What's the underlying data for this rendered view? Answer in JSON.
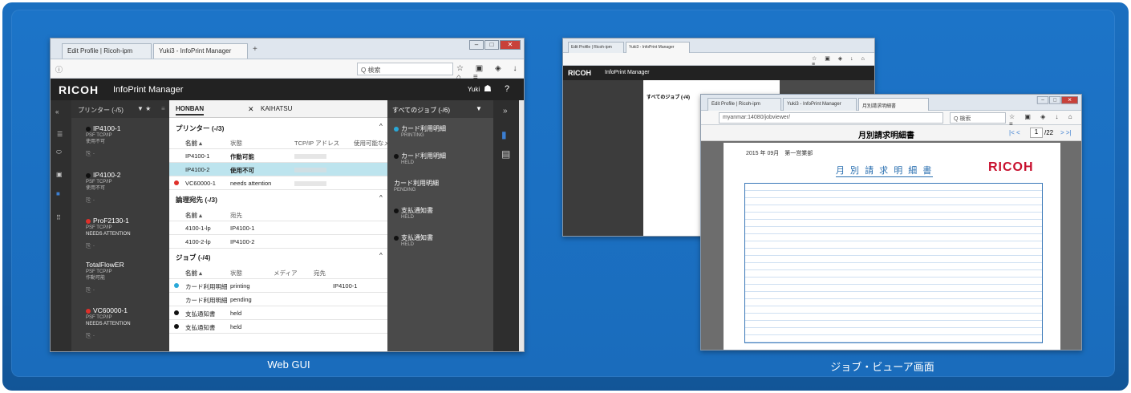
{
  "captions": {
    "left": "Web GUI",
    "right": "ジョブ・ビューア画面"
  },
  "left_window": {
    "tabs": [
      "Edit Profile | Ricoh-ipm",
      "Yuki3 - InfoPrint Manager"
    ],
    "search_placeholder": "Q 検索",
    "brand": "RICOH",
    "product": "InfoPrint Manager",
    "user": "Yuki",
    "help": "?",
    "sidebar_header": "プリンター (-/5)",
    "printers": [
      {
        "name": "IP4100-1",
        "sub1": "PSF TCP/IP",
        "sub2": "使用不可",
        "color": "#111"
      },
      {
        "name": "IP4100-2",
        "sub1": "PSF TCP/IP",
        "sub2": "使用不可",
        "color": "#111"
      },
      {
        "name": "ProF2130-1",
        "sub1": "PSF TCP/IP",
        "sub2": "NEEDS ATTENTION",
        "color": "#e0302a"
      },
      {
        "name": "TotalFlowER",
        "sub1": "PSF TCP/IP",
        "sub2": "作動可能",
        "color": ""
      },
      {
        "name": "VC60000-1",
        "sub1": "PSF TCP/IP",
        "sub2": "NEEDS ATTENTION",
        "color": "#e0302a"
      }
    ],
    "main_tabs": [
      "HONBAN",
      "KAIHATSU"
    ],
    "printer_section": {
      "title": "プリンター (-/3)",
      "headers": [
        "名前 ▴",
        "状態",
        "TCP/IP アドレス",
        "使用可能なメ"
      ],
      "rows": [
        [
          "IP4100-1",
          "作動可能"
        ],
        [
          "IP4100-2",
          "使用不可"
        ],
        [
          "VC60000-1",
          "needs attention"
        ]
      ]
    },
    "dest_section": {
      "title": "論理宛先 (-/3)",
      "headers": [
        "名前 ▴",
        "宛先"
      ],
      "rows": [
        [
          "4100-1-lp",
          "IP4100-1"
        ],
        [
          "4100-2-lp",
          "IP4100-2"
        ]
      ]
    },
    "job_section": {
      "title": "ジョブ (-/4)",
      "headers": [
        "名前 ▴",
        "状態",
        "メディア",
        "宛先"
      ],
      "rows": [
        [
          "カード利用明細",
          "printing",
          "IP4100-1"
        ],
        [
          "カード利用明細",
          "pending",
          ""
        ],
        [
          "支払通知書",
          "held",
          ""
        ],
        [
          "支払通知書",
          "held",
          ""
        ]
      ]
    },
    "jobs_header": "すべてのジョブ (-/6)",
    "jobs": [
      {
        "name": "カード利用明細",
        "status": "PRINTING"
      },
      {
        "name": "カード利用明細",
        "status": "HELD"
      },
      {
        "name": "カード利用明細",
        "status": "PENDING"
      },
      {
        "name": "支払通知書",
        "status": "HELD"
      },
      {
        "name": "支払通知書",
        "status": "HELD"
      }
    ]
  },
  "right_back_window": {
    "tabs": [
      "Edit Profile | Ricoh-ipm",
      "Yuki3 - InfoPrint Manager"
    ],
    "brand": "RICOH",
    "product": "InfoPrint Manager",
    "jobs_title": "すべてのジョブ (-/4)"
  },
  "right_front_window": {
    "tabs": [
      "Edit Profile | Ricoh-ipm",
      "Yuki3 - InfoPrint Manager",
      "月別請求明細書"
    ],
    "url": "myanmar:14080/jobviewer/",
    "search_placeholder": "Q 検索",
    "doc_title": "月別請求明細書",
    "page": "1",
    "page_total": "/22",
    "doc_heading": "月 別 請 求 明 細 書",
    "doc_brand": "RICOH",
    "doc_date": "2015 年 09月　第一営業部"
  }
}
